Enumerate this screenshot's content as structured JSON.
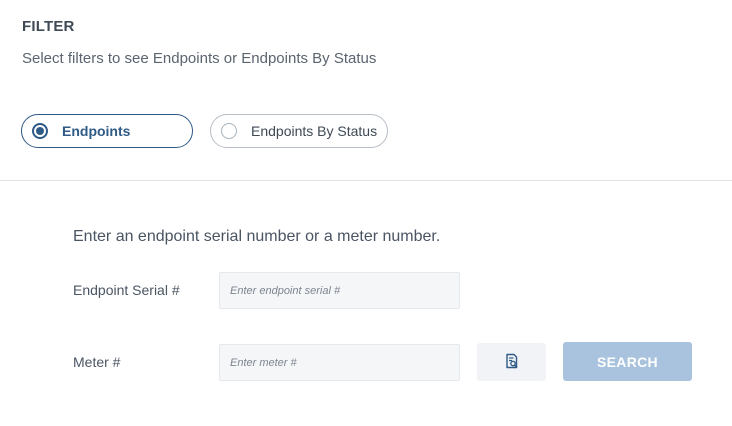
{
  "filter": {
    "heading": "FILTER",
    "subtitle": "Select filters to see Endpoints or Endpoints By Status"
  },
  "radio_options": [
    {
      "label": "Endpoints",
      "selected": true
    },
    {
      "label": "Endpoints By Status",
      "selected": false
    }
  ],
  "search_form": {
    "instructions": "Enter an endpoint serial number or a meter number.",
    "serial_label": "Endpoint Serial #",
    "serial_placeholder": "Enter endpoint serial #",
    "serial_value": "",
    "meter_label": "Meter #",
    "meter_placeholder": "Enter meter #",
    "meter_value": "",
    "lookup_icon": "document-search-icon",
    "search_button_label": "SEARCH"
  },
  "colors": {
    "accent": "#2f5a86",
    "search_button_disabled": "#a9c3de",
    "input_background": "#f5f6f8"
  }
}
